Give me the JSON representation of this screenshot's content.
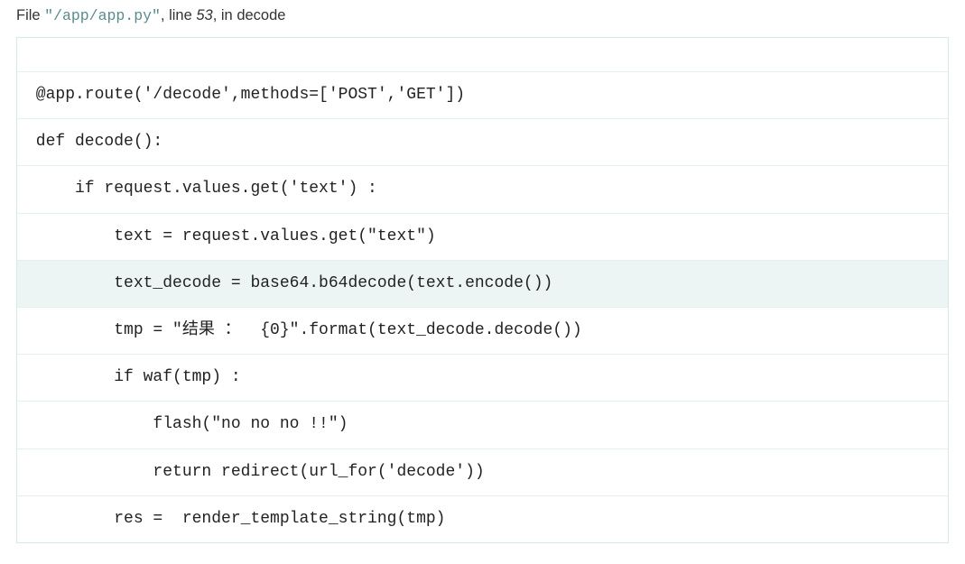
{
  "traceback": {
    "file_label": "File ",
    "file_path": "\"/app/app.py\"",
    "line_label": ", line ",
    "line_num": "53",
    "in_label": ", in ",
    "func_name": "decode"
  },
  "code_lines": [
    {
      "text": "",
      "blank": true,
      "highlighted": false
    },
    {
      "text": " @app.route('/decode',methods=['POST','GET'])",
      "blank": false,
      "highlighted": false
    },
    {
      "text": " def decode():",
      "blank": false,
      "highlighted": false
    },
    {
      "text": "     if request.values.get('text') :",
      "blank": false,
      "highlighted": false
    },
    {
      "text": "         text = request.values.get(\"text\")",
      "blank": false,
      "highlighted": false
    },
    {
      "text": "         text_decode = base64.b64decode(text.encode())",
      "blank": false,
      "highlighted": true
    },
    {
      "text": "         tmp = \"结果 ：  {0}\".format(text_decode.decode())",
      "blank": false,
      "highlighted": false
    },
    {
      "text": "         if waf(tmp) :",
      "blank": false,
      "highlighted": false
    },
    {
      "text": "             flash(\"no no no !!\")",
      "blank": false,
      "highlighted": false
    },
    {
      "text": "             return redirect(url_for('decode'))",
      "blank": false,
      "highlighted": false
    },
    {
      "text": "         res =  render_template_string(tmp)",
      "blank": false,
      "highlighted": false
    }
  ]
}
